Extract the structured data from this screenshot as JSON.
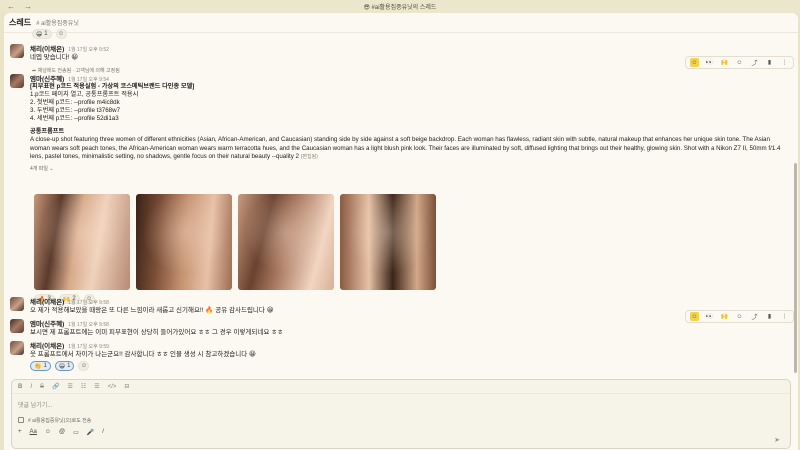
{
  "window": {
    "title": "#ai활용집중유닛의 스레드",
    "back": "←",
    "forward": "→"
  },
  "header": {
    "title": "스레드",
    "channel": "# ai활용집중유닛"
  },
  "top_reactions": [
    {
      "emoji": "😁",
      "count": "1"
    }
  ],
  "messages": [
    {
      "author": "채리(이채은)",
      "time": "1월 17일 오후 9:52",
      "text": "네엡 맞습니다! 😀"
    },
    {
      "pinned": "채널에도 전송됨 · 고객님에 의해 고정됨",
      "author": "엠마(신주혜)",
      "time": "1월 17일 오후 9:54",
      "heading": "[피부표현 p코드 적용실험 - 가상의 코스메틱브랜드 다인종 모델]",
      "lines": [
        "1.p코드 페이지 열고, 공통프롬프트 적용시",
        "2. 첫번째 p코드: --profile m4ic8dk",
        "3. 두번째 p코드: --profile t3768w7",
        "4. 세번째 p코드: --profile 52di1a3"
      ],
      "prompt_title": "공통프롬프트",
      "prompt": "A close-up shot featuring three women of different ethnicities (Asian, African-American, and Caucasian) standing side by side against a soft beige backdrop. Each woman has flawless, radiant skin with subtle, natural makeup that enhances her unique skin tone. The Asian woman wears soft peach tones, the African-American woman wears warm terracotta hues, and the Caucasian woman has a light blush pink look. Their faces are illuminated by soft, diffused lighting that brings out their healthy, glowing skin. Shot with a Nikon Z7 II, 50mm f/1.4 lens, pastel tones, minimalistic setting, no shadows, gentle focus on their natural beauty --quality 2",
      "edited": "(편집됨)",
      "file_count": "4개 파일",
      "reactions": [
        {
          "emoji": "🔥",
          "count": "3"
        },
        {
          "emoji": "🙌",
          "count": "2"
        }
      ]
    },
    {
      "author": "채리(이채은)",
      "time": "1월 17일 오후 9:58",
      "text": "오 제가 적용해보았을 때랑은 또 다른 느낌이라 새롭고 신기해요!! 🔥 공유 감사드립니다 😀"
    },
    {
      "author": "엠마(신주혜)",
      "time": "1월 17일 오후 9:58",
      "text": "보시면 제 프롬프트에는 이미 피부표현이 상당히 들어가있어요 ㅎㅎ 그 경우 이렇게되네요 ㅎㅎ"
    },
    {
      "author": "채리(이채은)",
      "time": "1월 17일 오후 9:59",
      "text": "웃 프롬프트에서 차이가 나는군요!! 감사합니다 ㅎㅎ 인물 생성 시 참고하겠습니다 😀",
      "reactions": [
        {
          "emoji": "👏",
          "count": "1"
        },
        {
          "emoji": "😁",
          "count": "1"
        }
      ]
    }
  ],
  "composer": {
    "toolbar": [
      "B",
      "I",
      "S",
      "🔗",
      "☰",
      "☷",
      "☰",
      "</>",
      "⊟"
    ],
    "placeholder": "댓글 남기기...",
    "also_send": "# ai활용집중유닛(으)로도 전송",
    "bottom": [
      "+",
      "Aa",
      "☺",
      "@",
      "▭",
      "🎤",
      "/"
    ]
  },
  "colors": {
    "accent": "#f2d34a",
    "panel": "#fbf9f1",
    "frame": "#e9e3c8"
  }
}
